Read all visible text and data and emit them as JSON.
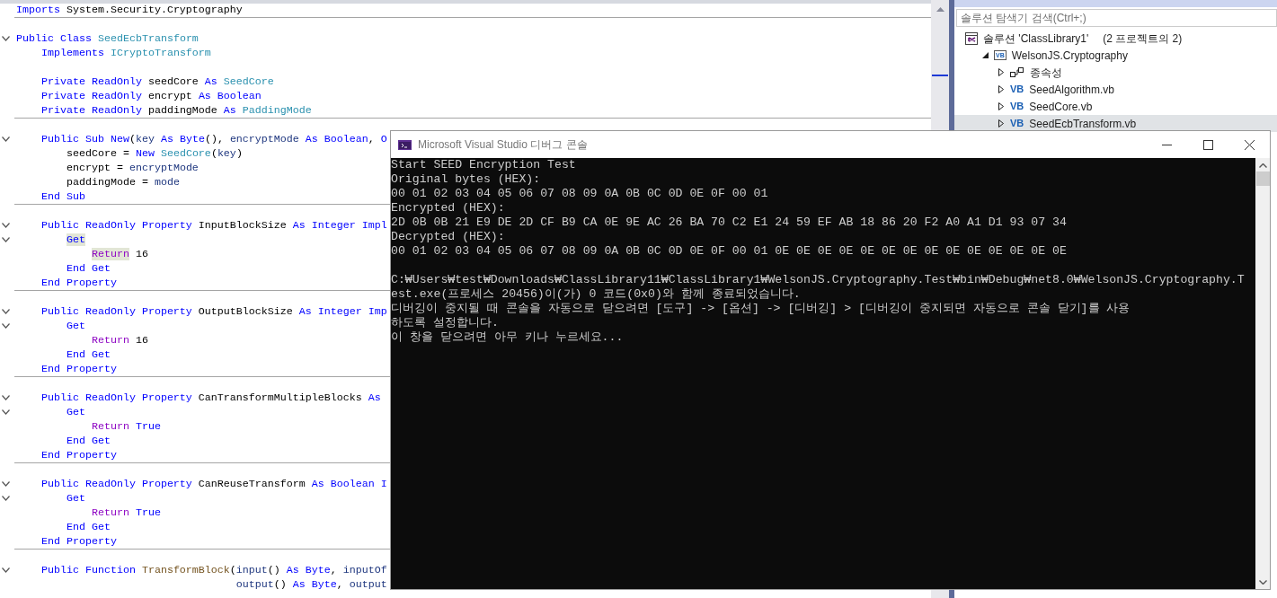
{
  "editor": {
    "blocks": [
      {
        "lines": [
          {
            "kind": "code",
            "tokens": [
              {
                "t": "Imports",
                "kind": "kw"
              },
              {
                "t": " System.Security.Cryptography",
                "kind": "plain"
              }
            ]
          }
        ]
      },
      {
        "lines": [
          {
            "kind": "blank"
          },
          {
            "kind": "code",
            "fold": true,
            "tokens": [
              {
                "t": "Public Class",
                "kind": "kw"
              },
              {
                "t": " SeedEcbTransform",
                "kind": "type"
              }
            ]
          },
          {
            "kind": "code",
            "tokens": [
              {
                "t": "    Implements",
                "kind": "kw"
              },
              {
                "t": " ICryptoTransform",
                "kind": "type"
              }
            ]
          },
          {
            "kind": "blank"
          },
          {
            "kind": "code",
            "tokens": [
              {
                "t": "    Private ReadOnly",
                "kind": "kw"
              },
              {
                "t": " seedCore ",
                "kind": "plain"
              },
              {
                "t": "As",
                "kind": "kw"
              },
              {
                "t": " SeedCore",
                "kind": "type"
              }
            ]
          },
          {
            "kind": "code",
            "tokens": [
              {
                "t": "    Private ReadOnly",
                "kind": "kw"
              },
              {
                "t": " encrypt ",
                "kind": "plain"
              },
              {
                "t": "As Boolean",
                "kind": "kw"
              }
            ]
          },
          {
            "kind": "code",
            "tokens": [
              {
                "t": "    Private ReadOnly",
                "kind": "kw"
              },
              {
                "t": " paddingMode ",
                "kind": "plain"
              },
              {
                "t": "As",
                "kind": "kw"
              },
              {
                "t": " PaddingMode",
                "kind": "type"
              }
            ]
          }
        ]
      },
      {
        "lines": [
          {
            "kind": "blank"
          },
          {
            "kind": "code",
            "fold": true,
            "tokens": [
              {
                "t": "    Public Sub New",
                "kind": "kw"
              },
              {
                "t": "(",
                "kind": "plain"
              },
              {
                "t": "key",
                "kind": "var"
              },
              {
                "t": " As Byte",
                "kind": "kw"
              },
              {
                "t": "(), ",
                "kind": "plain"
              },
              {
                "t": "encryptMode",
                "kind": "var"
              },
              {
                "t": " As Boolean",
                "kind": "kw"
              },
              {
                "t": ", ",
                "kind": "plain"
              },
              {
                "t": "O",
                "kind": "kw"
              }
            ]
          },
          {
            "kind": "code",
            "tokens": [
              {
                "t": "        seedCore = ",
                "kind": "plain"
              },
              {
                "t": "New",
                "kind": "kw"
              },
              {
                "t": " SeedCore",
                "kind": "type"
              },
              {
                "t": "(",
                "kind": "plain"
              },
              {
                "t": "key",
                "kind": "var"
              },
              {
                "t": ")",
                "kind": "plain"
              }
            ]
          },
          {
            "kind": "code",
            "tokens": [
              {
                "t": "        encrypt = ",
                "kind": "plain"
              },
              {
                "t": "encryptMode",
                "kind": "var"
              }
            ]
          },
          {
            "kind": "code",
            "tokens": [
              {
                "t": "        paddingMode = ",
                "kind": "plain"
              },
              {
                "t": "mode",
                "kind": "var"
              }
            ]
          },
          {
            "kind": "code",
            "tokens": [
              {
                "t": "    End Sub",
                "kind": "kw"
              }
            ]
          }
        ]
      },
      {
        "lines": [
          {
            "kind": "blank"
          },
          {
            "kind": "code",
            "fold": true,
            "tokens": [
              {
                "t": "    Public ReadOnly Property",
                "kind": "kw"
              },
              {
                "t": " InputBlockSize ",
                "kind": "plain"
              },
              {
                "t": "As Integer Impl",
                "kind": "kw"
              }
            ]
          },
          {
            "kind": "code",
            "fold": true,
            "tokens": [
              {
                "t": "        Get",
                "kind": "kw",
                "highlight": true
              }
            ]
          },
          {
            "kind": "code",
            "tokens": [
              {
                "t": "            Return",
                "kind": "ctrl",
                "highlight": true
              },
              {
                "t": " 16",
                "kind": "plain"
              }
            ]
          },
          {
            "kind": "code",
            "tokens": [
              {
                "t": "        End Get",
                "kind": "kw"
              }
            ]
          },
          {
            "kind": "code",
            "tokens": [
              {
                "t": "    End Property",
                "kind": "kw"
              }
            ]
          }
        ]
      },
      {
        "lines": [
          {
            "kind": "blank"
          },
          {
            "kind": "code",
            "fold": true,
            "tokens": [
              {
                "t": "    Public ReadOnly Property",
                "kind": "kw"
              },
              {
                "t": " OutputBlockSize ",
                "kind": "plain"
              },
              {
                "t": "As Integer Imp",
                "kind": "kw"
              }
            ]
          },
          {
            "kind": "code",
            "fold": true,
            "tokens": [
              {
                "t": "        Get",
                "kind": "kw"
              }
            ]
          },
          {
            "kind": "code",
            "tokens": [
              {
                "t": "            Return",
                "kind": "ctrl"
              },
              {
                "t": " 16",
                "kind": "plain"
              }
            ]
          },
          {
            "kind": "code",
            "tokens": [
              {
                "t": "        End Get",
                "kind": "kw"
              }
            ]
          },
          {
            "kind": "code",
            "tokens": [
              {
                "t": "    End Property",
                "kind": "kw"
              }
            ]
          }
        ]
      },
      {
        "lines": [
          {
            "kind": "blank"
          },
          {
            "kind": "code",
            "fold": true,
            "tokens": [
              {
                "t": "    Public ReadOnly Property",
                "kind": "kw"
              },
              {
                "t": " CanTransformMultipleBlocks ",
                "kind": "plain"
              },
              {
                "t": "As",
                "kind": "kw"
              }
            ]
          },
          {
            "kind": "code",
            "fold": true,
            "tokens": [
              {
                "t": "        Get",
                "kind": "kw"
              }
            ]
          },
          {
            "kind": "code",
            "tokens": [
              {
                "t": "            Return",
                "kind": "ctrl"
              },
              {
                "t": " True",
                "kind": "kw"
              }
            ]
          },
          {
            "kind": "code",
            "tokens": [
              {
                "t": "        End Get",
                "kind": "kw"
              }
            ]
          },
          {
            "kind": "code",
            "tokens": [
              {
                "t": "    End Property",
                "kind": "kw"
              }
            ]
          }
        ]
      },
      {
        "lines": [
          {
            "kind": "blank"
          },
          {
            "kind": "code",
            "fold": true,
            "tokens": [
              {
                "t": "    Public ReadOnly Property",
                "kind": "kw"
              },
              {
                "t": " CanReuseTransform ",
                "kind": "plain"
              },
              {
                "t": "As Boolean I",
                "kind": "kw"
              }
            ]
          },
          {
            "kind": "code",
            "fold": true,
            "tokens": [
              {
                "t": "        Get",
                "kind": "kw"
              }
            ]
          },
          {
            "kind": "code",
            "tokens": [
              {
                "t": "            Return",
                "kind": "ctrl"
              },
              {
                "t": " True",
                "kind": "kw"
              }
            ]
          },
          {
            "kind": "code",
            "tokens": [
              {
                "t": "        End Get",
                "kind": "kw"
              }
            ]
          },
          {
            "kind": "code",
            "tokens": [
              {
                "t": "    End Property",
                "kind": "kw"
              }
            ]
          }
        ]
      },
      {
        "lines": [
          {
            "kind": "blank"
          },
          {
            "kind": "code",
            "fold": true,
            "tokens": [
              {
                "t": "    Public Function",
                "kind": "kw"
              },
              {
                "t": " TransformBlock",
                "kind": "func"
              },
              {
                "t": "(",
                "kind": "plain"
              },
              {
                "t": "input",
                "kind": "var"
              },
              {
                "t": "() ",
                "kind": "plain"
              },
              {
                "t": "As Byte",
                "kind": "kw"
              },
              {
                "t": ", ",
                "kind": "plain"
              },
              {
                "t": "inputOf",
                "kind": "var"
              }
            ]
          },
          {
            "kind": "code",
            "tokens": [
              {
                "t": "                                   output",
                "kind": "var"
              },
              {
                "t": "() ",
                "kind": "plain"
              },
              {
                "t": "As Byte",
                "kind": "kw"
              },
              {
                "t": ", ",
                "kind": "plain"
              },
              {
                "t": "output",
                "kind": "var"
              }
            ]
          }
        ]
      }
    ]
  },
  "solution_explorer": {
    "search": {
      "placeholder": "솔루션 탐색기 검색(Ctrl+;)"
    },
    "tree": [
      {
        "kind": "solution",
        "label": "솔루션 'ClassLibrary1'",
        "detail": "(2 프로젝트의 2)",
        "selected": false,
        "children": [
          {
            "kind": "project",
            "badge": "VB",
            "label": "WelsonJS.Cryptography",
            "expanded": true,
            "selected": false,
            "children": [
              {
                "kind": "dependencies",
                "label": "종속성",
                "expanded": false,
                "selected": false
              },
              {
                "kind": "file",
                "badge": "VB",
                "label": "SeedAlgorithm.vb",
                "expanded": false,
                "selected": false
              },
              {
                "kind": "file",
                "badge": "VB",
                "label": "SeedCore.vb",
                "expanded": false,
                "selected": false
              },
              {
                "kind": "file",
                "badge": "VB",
                "label": "SeedEcbTransform.vb",
                "expanded": false,
                "selected": true
              }
            ]
          }
        ]
      }
    ]
  },
  "console": {
    "title": "Microsoft Visual Studio 디버그 콘솔",
    "paragraphs": [
      [
        "Start SEED Encryption Test",
        "Original bytes (HEX):",
        "00 01 02 03 04 05 06 07 08 09 0A 0B 0C 0D 0E 0F 00 01",
        "Encrypted (HEX):",
        "2D 0B 0B 21 E9 DE 2D CF B9 CA 0E 9E AC 26 BA 70 C2 E1 24 59 EF AB 18 86 20 F2 A0 A1 D1 93 07 34",
        "Decrypted (HEX):",
        "00 01 02 03 04 05 06 07 08 09 0A 0B 0C 0D 0E 0F 00 01 0E 0E 0E 0E 0E 0E 0E 0E 0E 0E 0E 0E 0E 0E"
      ],
      [
        "C:₩Users₩test₩Downloads₩ClassLibrary11₩ClassLibrary1₩WelsonJS.Cryptography.Test₩bin₩Debug₩net8.0₩WelsonJS.Cryptography.T",
        "est.exe(프로세스 20456)이(가) 0 코드(0x0)와 함께 종료되었습니다.",
        "디버깅이 중지될 때 콘솔을 자동으로 닫으려면 [도구] -> [옵션] -> [디버깅] > [디버깅이 중지되면 자동으로 콘솔 닫기]를 사용",
        "하도록 설정합니다.",
        "이 창을 닫으려면 아무 키나 누르세요..."
      ]
    ]
  }
}
